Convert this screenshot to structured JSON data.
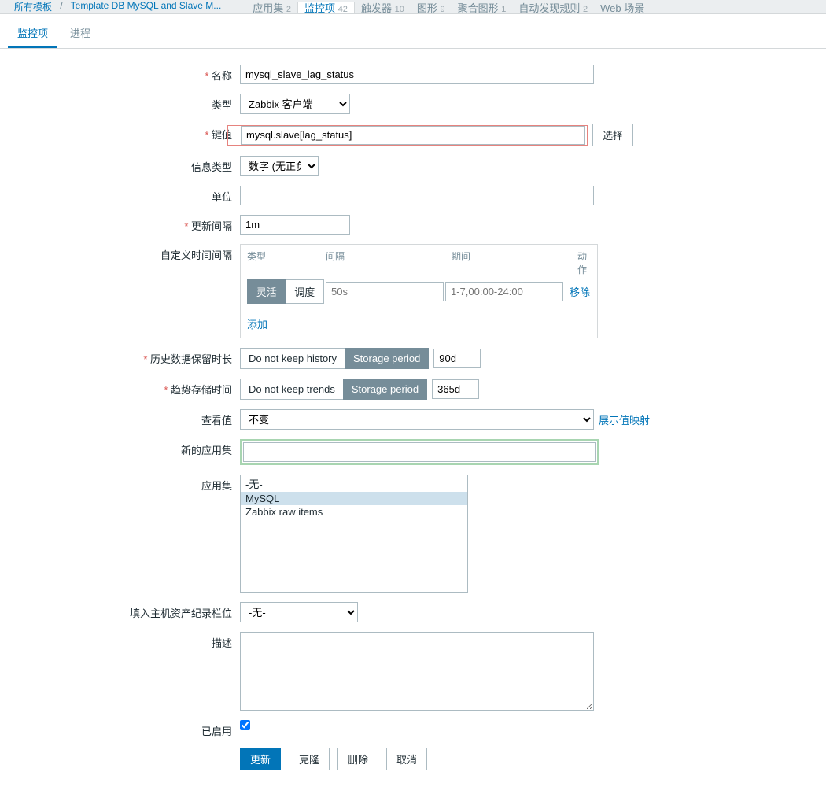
{
  "breadcrumb": {
    "all_templates": "所有模板",
    "template_name": "Template DB MySQL and Slave M...",
    "tabs": [
      {
        "label": "应用集",
        "count": "2"
      },
      {
        "label": "监控项",
        "count": "42",
        "active": true
      },
      {
        "label": "触发器",
        "count": "10"
      },
      {
        "label": "图形",
        "count": "9"
      },
      {
        "label": "聚合图形",
        "count": "1"
      },
      {
        "label": "自动发现规则",
        "count": "2"
      },
      {
        "label": "Web 场景",
        "count": ""
      }
    ]
  },
  "subtabs": {
    "item": "监控项",
    "process": "进程"
  },
  "labels": {
    "name": "名称",
    "type": "类型",
    "key": "键值",
    "info_type": "信息类型",
    "unit": "单位",
    "update_interval": "更新间隔",
    "custom_intervals": "自定义时间间隔",
    "history": "历史数据保留时长",
    "trends": "趋势存储时间",
    "show_value": "查看值",
    "new_app": "新的应用集",
    "apps": "应用集",
    "inventory": "填入主机资产纪录栏位",
    "description": "描述",
    "enabled": "已启用"
  },
  "values": {
    "name": "mysql_slave_lag_status",
    "type": "Zabbix 客户端",
    "key": "mysql.slave[lag_status]",
    "info_type": "数字 (无正负)",
    "unit": "",
    "update_interval": "1m",
    "show_value": "不变",
    "show_value_link": "展示值映射",
    "new_app": "",
    "inventory": "-无-",
    "description": "",
    "enabled": true
  },
  "intervals": {
    "headers": {
      "type": "类型",
      "interval": "间隔",
      "period": "期间",
      "action": "动作"
    },
    "row": {
      "flex": "灵活",
      "sched": "调度",
      "interval": "50s",
      "period": "1-7,00:00-24:00",
      "remove": "移除"
    },
    "add": "添加"
  },
  "history": {
    "nokeep": "Do not keep history",
    "storage": "Storage period",
    "value": "90d"
  },
  "trends": {
    "nokeep": "Do not keep trends",
    "storage": "Storage period",
    "value": "365d"
  },
  "apps_list": [
    "-无-",
    "MySQL",
    "Zabbix raw items"
  ],
  "apps_selected": 1,
  "select_btn": "选择",
  "actions": {
    "update": "更新",
    "clone": "克隆",
    "delete": "删除",
    "cancel": "取消"
  }
}
